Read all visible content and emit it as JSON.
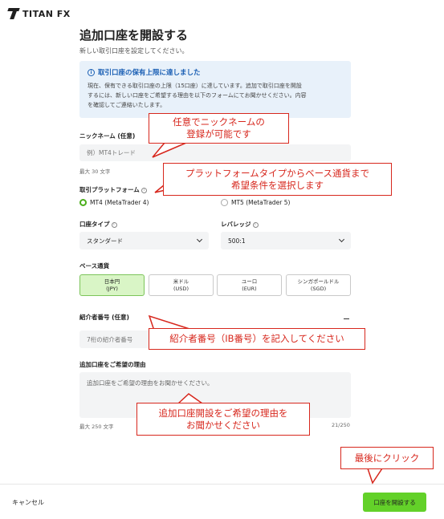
{
  "logo": {
    "text": "TITAN FX"
  },
  "page": {
    "title": "追加口座を開設する",
    "subtitle": "新しい取引口座を設定してください。"
  },
  "info": {
    "heading": "取引口座の保有上限に達しました",
    "body_line1": "現在、保有できる取引口座の上限（15口座）に達しています。追加で取引口座を開設",
    "body_line2": "するには、新しい口座をご希望する理由を以下のフォームにてお聞かせください。内容",
    "body_line3": "を確認してご連絡いたします。"
  },
  "nickname": {
    "label": "ニックネーム (任意)",
    "placeholder": "例）MT4トレード",
    "hint": "最大 30 文字"
  },
  "platform": {
    "label": "取引プラットフォーム",
    "options": [
      {
        "label": "MT4 (MetaTrader 4)",
        "selected": true
      },
      {
        "label": "MT5 (MetaTrader 5)",
        "selected": false
      }
    ]
  },
  "account_type": {
    "label": "口座タイプ",
    "value": "スタンダード"
  },
  "leverage": {
    "label": "レバレッジ",
    "value": "500:1"
  },
  "base_currency": {
    "label": "ベース通貨",
    "options": [
      {
        "name": "日本円",
        "code": "(JPY)",
        "selected": true
      },
      {
        "name": "米ドル",
        "code": "(USD)",
        "selected": false
      },
      {
        "name": "ユーロ",
        "code": "(EUR)",
        "selected": false
      },
      {
        "name": "シンガポールドル",
        "code": "(SGD)",
        "selected": false
      }
    ]
  },
  "referrer": {
    "label": "紹介者番号 (任意)",
    "placeholder": "7桁の紹介者番号"
  },
  "reason": {
    "label": "追加口座をご希望の理由",
    "placeholder": "追加口座をご希望の理由をお聞かせください。",
    "hint": "最大 250 文字",
    "counter": "21/250"
  },
  "footer": {
    "cancel": "キャンセル",
    "submit": "口座を開設する"
  },
  "annotations": {
    "a1_line1": "任意でニックネームの",
    "a1_line2": "登録が可能です",
    "a2_line1": "プラットフォームタイプからベース通貨まで",
    "a2_line2": "希望条件を選択します",
    "a3": "紹介者番号（IB番号）を記入してください",
    "a4_line1": "追加口座開設をご希望の理由を",
    "a4_line2": "お聞かせください",
    "a5": "最後にクリック",
    "color": "#d7271d"
  },
  "colors": {
    "accent": "#63d129",
    "info_bg": "#e8f1fa",
    "info_text": "#1a5fb4"
  }
}
